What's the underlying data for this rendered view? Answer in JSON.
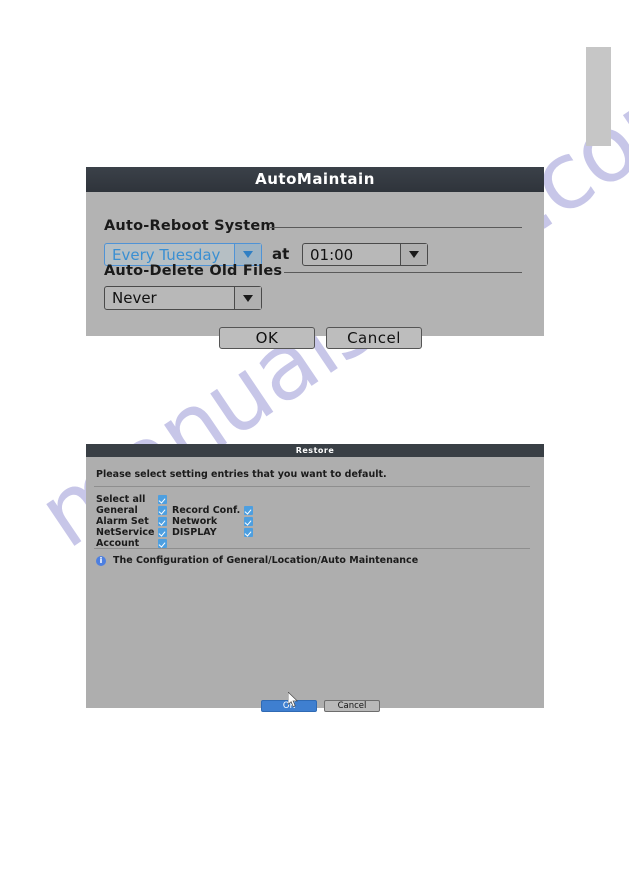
{
  "page": {
    "background_color": "#ffffff",
    "watermark_text": "manualshive.com",
    "watermark_color": "#7a76c8",
    "side_tab_color": "#c6c6c6"
  },
  "automaintain_dialog": {
    "title": "AutoMaintain",
    "titlebar_color": "#343a40",
    "body_color": "#b3b3b3",
    "groups": [
      {
        "label": "Auto-Reboot System"
      },
      {
        "label": "Auto-Delete Old Files"
      }
    ],
    "reboot_day": {
      "value": "Every Tuesday",
      "focused": true,
      "focus_color": "#3a8fd2"
    },
    "at_label": "at",
    "reboot_time": {
      "value": "01:00",
      "focused": false
    },
    "delete_old_files": {
      "value": "Never",
      "focused": false
    },
    "buttons": {
      "ok": "OK",
      "cancel": "Cancel"
    }
  },
  "restore_dialog": {
    "title": "Restore",
    "titlebar_color": "#393f45",
    "body_color": "#aeaeae",
    "instruction": "Please select setting entries that you want to default.",
    "checkbox_color": "#4d9fe0",
    "entries_left": [
      {
        "label": "Select all",
        "checked": true
      },
      {
        "label": "General",
        "checked": true
      },
      {
        "label": "Alarm Set",
        "checked": true
      },
      {
        "label": "NetService",
        "checked": true
      },
      {
        "label": "Account",
        "checked": true
      }
    ],
    "entries_right": [
      {
        "label": "Record Conf.",
        "checked": true
      },
      {
        "label": "Network",
        "checked": true
      },
      {
        "label": "DISPLAY",
        "checked": true
      }
    ],
    "info": {
      "icon": "info-icon",
      "glyph": "i",
      "text": "The Configuration of General/Location/Auto Maintenance"
    },
    "buttons": {
      "ok": "OK",
      "cancel": "Cancel",
      "ok_highlighted": true,
      "ok_color": "#3f7fd0"
    }
  }
}
